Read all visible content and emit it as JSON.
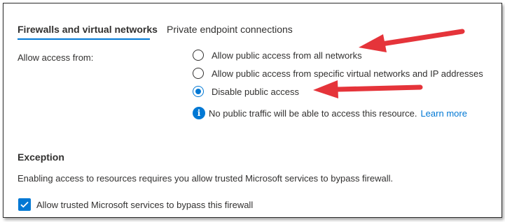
{
  "tabs": [
    {
      "label": "Firewalls and virtual networks",
      "selected": true
    },
    {
      "label": "Private endpoint connections",
      "selected": false
    }
  ],
  "access": {
    "label": "Allow access from:",
    "options": [
      {
        "label": "Allow public access from all networks",
        "checked": false
      },
      {
        "label": "Allow public access from specific virtual networks and IP addresses",
        "checked": false
      },
      {
        "label": "Disable public access",
        "checked": true
      }
    ],
    "info_text": "No public traffic will be able to access this resource.",
    "learn_more": "Learn more"
  },
  "exception": {
    "title": "Exception",
    "description": "Enabling access to resources requires you allow trusted Microsoft services to bypass firewall.",
    "checkbox_label": "Allow trusted Microsoft services to bypass this firewall",
    "checkbox_checked": true
  },
  "icons": {
    "info": "info-icon",
    "check": "checkmark-icon",
    "annotation": "red-arrow-icon"
  },
  "colors": {
    "accent": "#0078d4",
    "annotation": "#e5343a",
    "text": "#323130"
  }
}
